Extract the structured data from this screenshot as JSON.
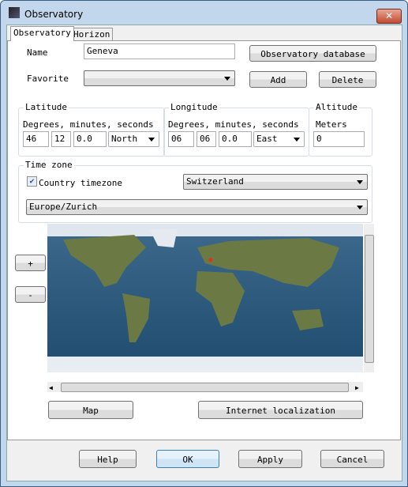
{
  "window": {
    "title": "Observatory",
    "close_icon": "close-icon"
  },
  "tabs": [
    {
      "label": "Observatory",
      "active": true
    },
    {
      "label": "Horizon",
      "active": false
    }
  ],
  "name": {
    "label": "Name",
    "value": "Geneva"
  },
  "favorite": {
    "label": "Favorite",
    "value": ""
  },
  "buttons": {
    "database": "Observatory database",
    "add": "Add",
    "delete": "Delete",
    "zoom_in": "+",
    "zoom_out": "-",
    "map": "Map",
    "internet": "Internet localization",
    "help": "Help",
    "ok": "OK",
    "apply": "Apply",
    "cancel": "Cancel"
  },
  "latitude": {
    "title": "Latitude",
    "sub": "Degrees, minutes, seconds",
    "deg": "46",
    "min": "12",
    "sec": "0.0",
    "hemi": "North"
  },
  "longitude": {
    "title": "Longitude",
    "sub": "Degrees, minutes, seconds",
    "deg": "06",
    "min": "06",
    "sec": "0.0",
    "hemi": "East"
  },
  "altitude": {
    "title": "Altitude",
    "sub": "Meters",
    "value": "0"
  },
  "timezone": {
    "title": "Time zone",
    "country_label": "Country timezone",
    "country_checked": true,
    "country": "Switzerland",
    "zone": "Europe/Zurich"
  },
  "map": {
    "marker_lat": 46.2,
    "marker_lon": 6.1,
    "ocean_color": "#2d5a7c",
    "land_color": "#6b7a45",
    "marker_color": "#e03020"
  }
}
